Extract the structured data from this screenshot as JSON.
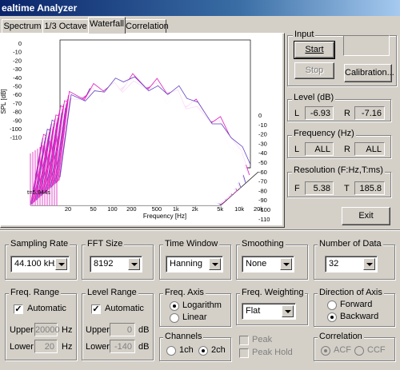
{
  "window": {
    "title": "ealtime Analyzer"
  },
  "tabs": [
    {
      "label": "Spectrum"
    },
    {
      "label": "1/3 Octave"
    },
    {
      "label": "Waterfall"
    },
    {
      "label": "Correlation"
    }
  ],
  "input": {
    "group_label": "Input",
    "start_label": "Start",
    "stop_label": "Stop",
    "calibration_label": "Calibration...",
    "display_value": ""
  },
  "level": {
    "group_label": "Level (dB)",
    "l_label": "L",
    "l_value": "-6.93",
    "r_label": "R",
    "r_value": "-7.16"
  },
  "frequency": {
    "group_label": "Frequency (Hz)",
    "l_label": "L",
    "l_value": "ALL",
    "r_label": "R",
    "r_value": "ALL"
  },
  "resolution": {
    "group_label": "Resolution (F:Hz,T:ms)",
    "f_label": "F",
    "f_value": "5.38",
    "t_label": "T",
    "t_value": "185.8"
  },
  "exit_label": "Exit",
  "sampling_rate": {
    "label": "Sampling Rate",
    "value": "44.100 kHz"
  },
  "fft_size": {
    "label": "FFT Size",
    "value": "8192"
  },
  "time_window": {
    "label": "Time Window",
    "value": "Hanning"
  },
  "smoothing": {
    "label": "Smoothing",
    "value": "None"
  },
  "number_of_data": {
    "label": "Number of Data",
    "value": "32"
  },
  "freq_range": {
    "label": "Freq. Range",
    "automatic_label": "Automatic",
    "automatic": true,
    "upper_label": "Upper",
    "upper_value": "20000",
    "upper_unit": "Hz",
    "lower_label": "Lower",
    "lower_value": "20",
    "lower_unit": "Hz"
  },
  "level_range": {
    "label": "Level Range",
    "automatic_label": "Automatic",
    "automatic": true,
    "upper_label": "Upper",
    "upper_value": "0",
    "upper_unit": "dB",
    "lower_label": "Lower",
    "lower_value": "-140",
    "lower_unit": "dB"
  },
  "freq_axis": {
    "label": "Freq. Axis",
    "options": [
      "Logarithm",
      "Linear"
    ],
    "selected": "Logarithm"
  },
  "channels": {
    "label": "Channels",
    "options": [
      "1ch",
      "2ch"
    ],
    "selected": "2ch"
  },
  "freq_weighting": {
    "label": "Freq. Weighting",
    "value": "Flat"
  },
  "peak": {
    "peak_label": "Peak",
    "peak_hold_label": "Peak Hold"
  },
  "direction_of_axis": {
    "label": "Direction of Axis",
    "options": [
      "Forward",
      "Backward"
    ],
    "selected": "Backward"
  },
  "correlation": {
    "label": "Correlation",
    "options": [
      "ACF",
      "CCF"
    ],
    "selected": "ACF"
  },
  "colors": {
    "trace": "#e020c0",
    "trace_alt": "#6040c0",
    "title_bar": "#0a246a"
  },
  "chart_data": {
    "type": "line",
    "title": "",
    "ylabel": "SPL [dB]",
    "xlabel": "Frequency [Hz]",
    "y_ticks": [
      "0",
      "-10",
      "-20",
      "-30",
      "-40",
      "-50",
      "-60",
      "-70",
      "-80",
      "-90",
      "-100",
      "-110"
    ],
    "z_ticks": [
      "0",
      "-10",
      "-20",
      "-30",
      "-40",
      "-50",
      "-60",
      "-70",
      "-80",
      "-90",
      "-100",
      "-110"
    ],
    "x_ticks": [
      "20",
      "50",
      "100",
      "200",
      "500",
      "1k",
      "2k",
      "5k",
      "10k",
      "20k"
    ],
    "x_tick_values": [
      20,
      50,
      100,
      200,
      500,
      1000,
      2000,
      5000,
      10000,
      20000
    ],
    "x_scale": "log",
    "ylim": [
      -110,
      0
    ],
    "time_label": "t=5.944s",
    "series_count": 32,
    "front_series": {
      "x": [
        20,
        30,
        50,
        70,
        100,
        150,
        200,
        300,
        500,
        700,
        1000,
        1500,
        2000,
        3000,
        5000,
        7000,
        10000,
        15000,
        20000
      ],
      "y": [
        -108,
        -46,
        -42,
        -40,
        -38,
        -36,
        -33,
        -32,
        -34,
        -36,
        -40,
        -42,
        -46,
        -52,
        -60,
        -66,
        -74,
        -90,
        -98
      ]
    }
  }
}
